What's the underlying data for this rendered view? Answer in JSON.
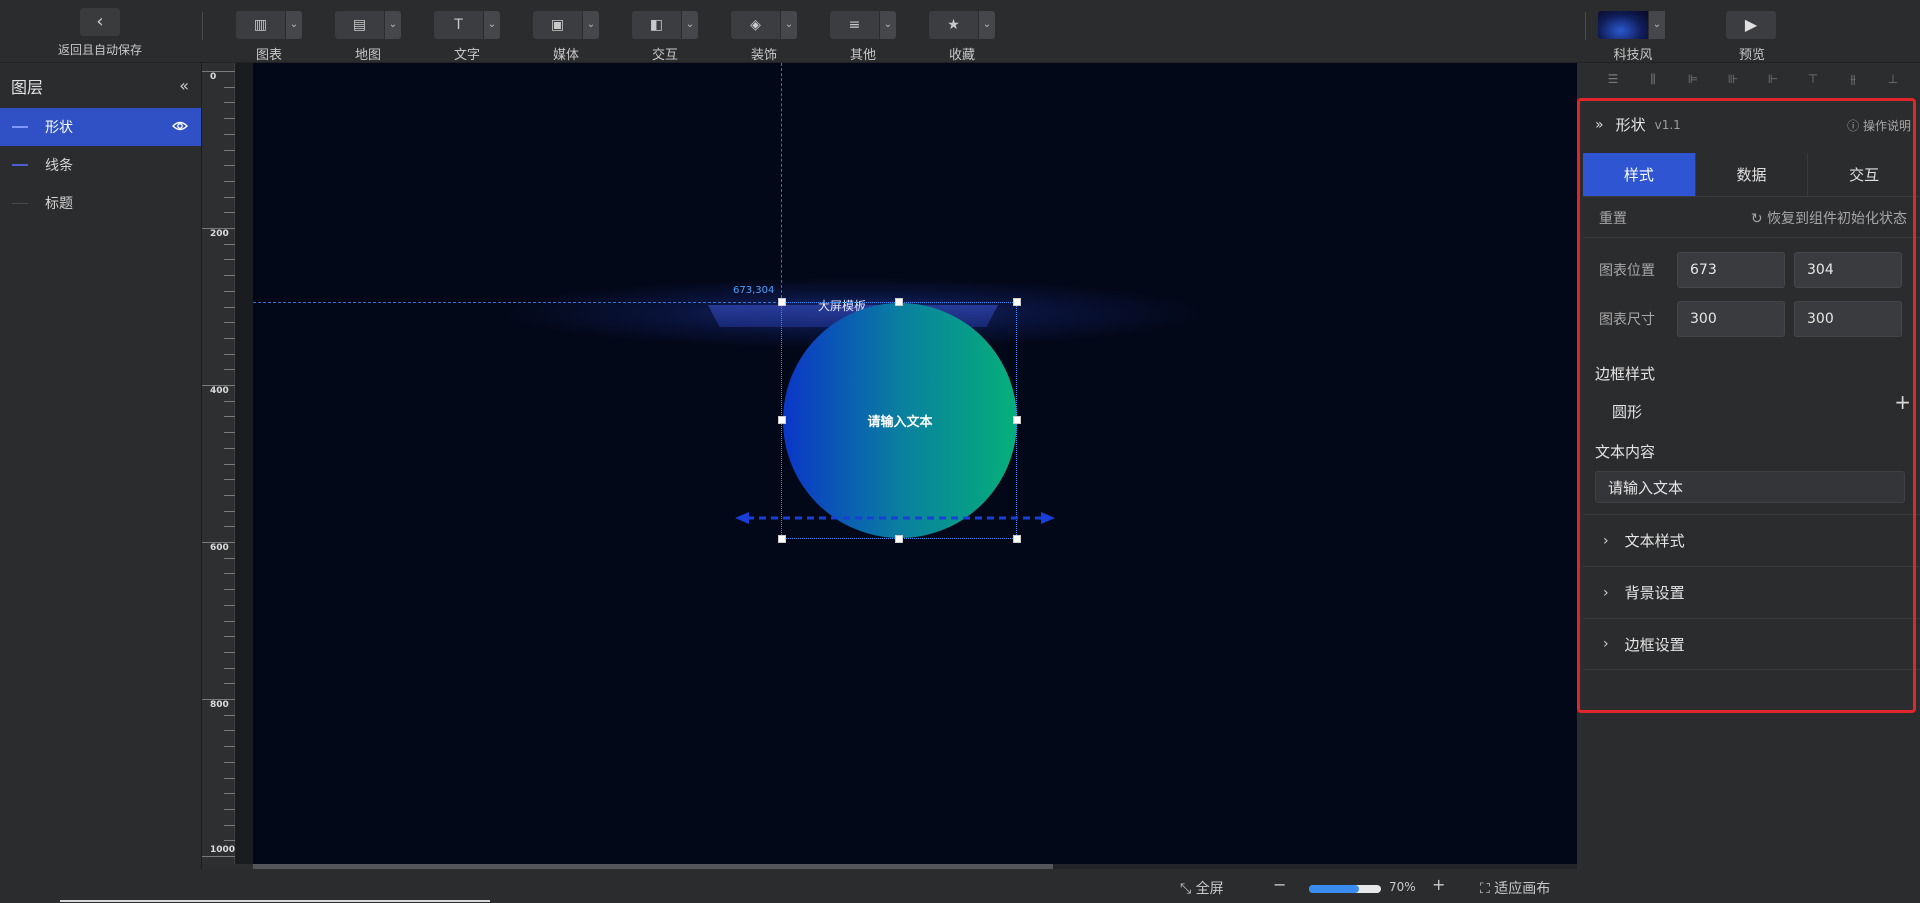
{
  "toolbar": {
    "back_label": "返回且自动保存",
    "tools": [
      {
        "label": "图表",
        "icon": "bar-chart-icon"
      },
      {
        "label": "地图",
        "icon": "map-icon"
      },
      {
        "label": "文字",
        "icon": "text-icon"
      },
      {
        "label": "媒体",
        "icon": "media-icon"
      },
      {
        "label": "交互",
        "icon": "interaction-icon"
      },
      {
        "label": "装饰",
        "icon": "decoration-icon"
      },
      {
        "label": "其他",
        "icon": "other-icon"
      },
      {
        "label": "收藏",
        "icon": "stars-icon"
      }
    ],
    "theme_label": "科技风",
    "preview_label": "预览"
  },
  "layers": {
    "title": "图层",
    "items": [
      {
        "label": "形状",
        "active": true
      },
      {
        "label": "线条",
        "active": false
      },
      {
        "label": "标题",
        "active": false
      }
    ]
  },
  "ruler": {
    "labels": [
      "0",
      "200",
      "400",
      "600",
      "800",
      "1000"
    ]
  },
  "canvas": {
    "coord_label": "673,304",
    "title_text": "大屏模板",
    "shape_text": "请输入文本",
    "background": "#030819",
    "accent": "#3a8cff"
  },
  "panel": {
    "title": "形状",
    "version": "v1.1",
    "help_label": "操作说明",
    "tabs": [
      {
        "label": "样式",
        "active": true
      },
      {
        "label": "数据",
        "active": false
      },
      {
        "label": "交互",
        "active": false
      }
    ],
    "reset_label": "重置",
    "restore_label": "恢复到组件初始化状态",
    "position_label": "图表位置",
    "position_x": "673",
    "position_y": "304",
    "size_label": "图表尺寸",
    "size_w": "300",
    "size_h": "300",
    "border_style_label": "边框样式",
    "border_style_value": "圆形",
    "text_content_label": "文本内容",
    "text_content_value": "请输入文本",
    "sections": [
      "文本样式",
      "背景设置",
      "边框设置"
    ],
    "highlight_color": "#e0262a",
    "tab_active_color": "#2f55d3"
  },
  "bottom": {
    "fullscreen_label": "全屏",
    "zoom_level": "70%",
    "zoom_fraction": 0.7,
    "fit_label": "适应画布"
  }
}
